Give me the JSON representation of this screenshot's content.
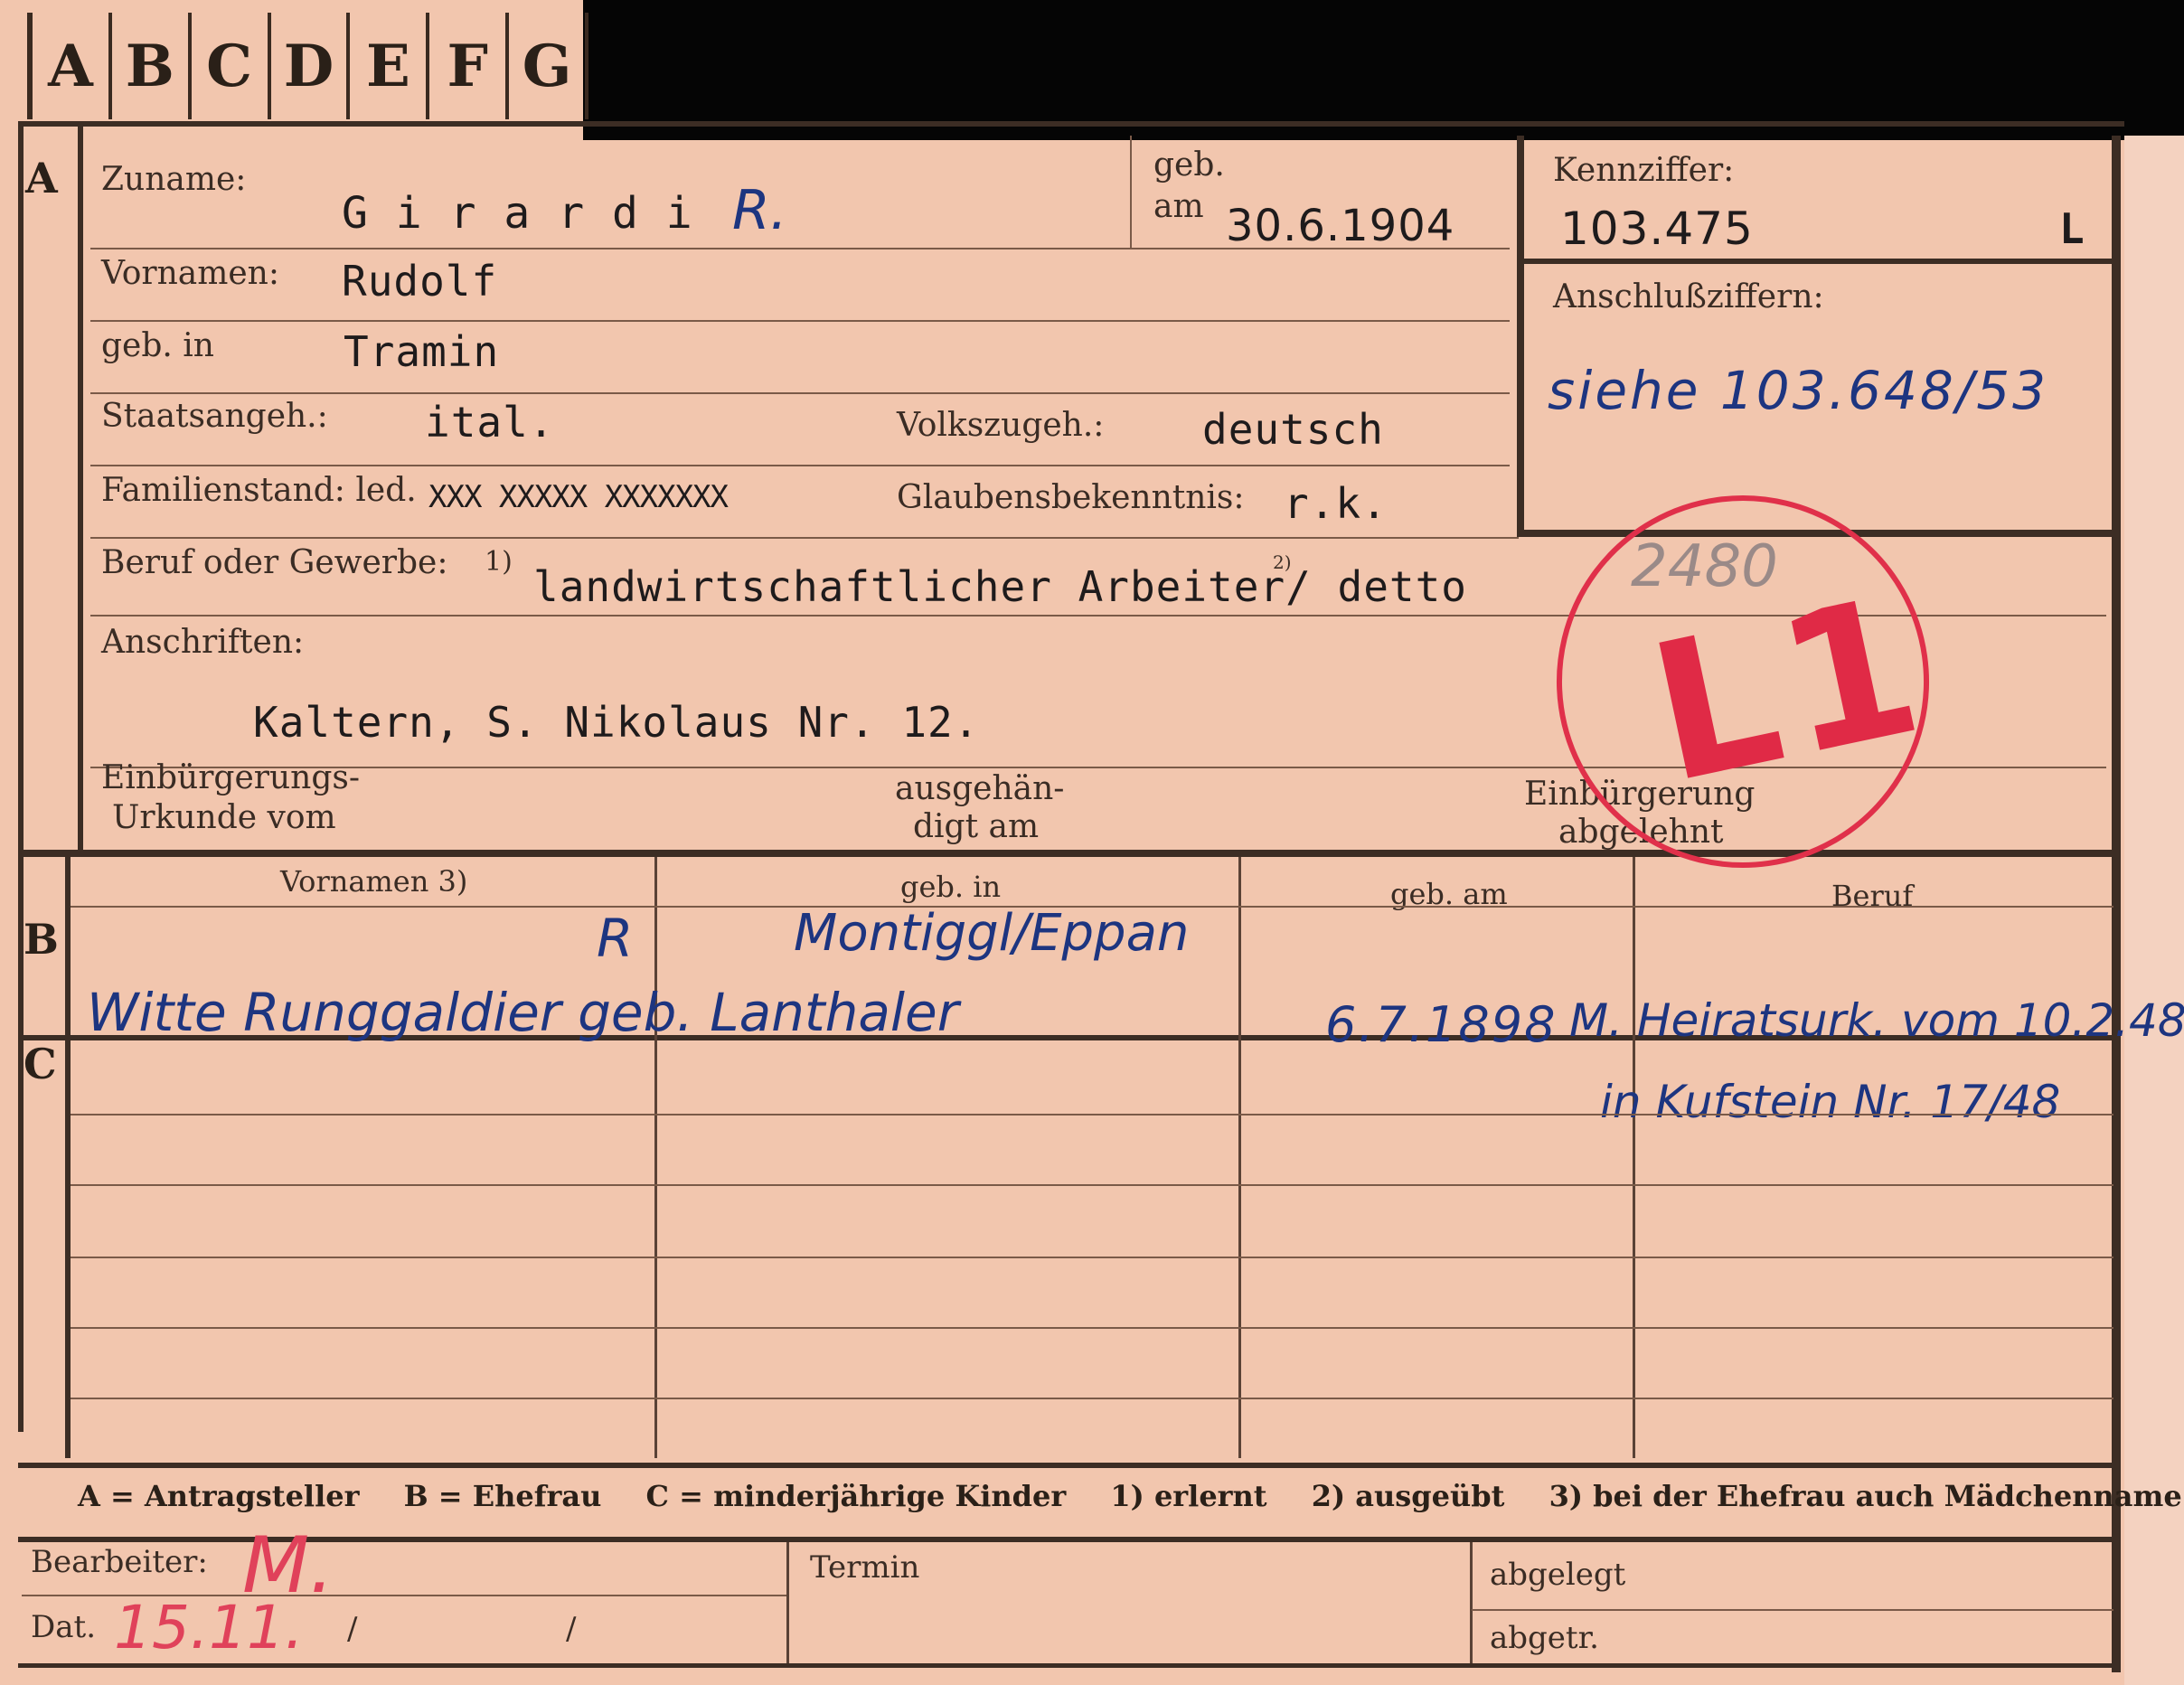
{
  "tabs": [
    "A",
    "B",
    "C",
    "D",
    "E",
    "F",
    "G"
  ],
  "sections": {
    "a": "A",
    "b": "B",
    "c": "C"
  },
  "labels": {
    "zuname": "Zuname:",
    "geb": "geb.",
    "am": "am",
    "vornamen": "Vornamen:",
    "geb_in": "geb. in",
    "staatsangeh": "Staatsangeh.:",
    "volkszugeh": "Volkszugeh.:",
    "familienstand": "Familienstand: led.",
    "glaubensbekenntnis": "Glaubensbekenntnis:",
    "beruf": "Beruf oder Gewerbe:",
    "footnote1": "1)",
    "footnote2": "2)",
    "anschriften": "Anschriften:",
    "einbuergerungs_1": "Einbürgerungs-",
    "einbuergerungs_2": "Urkunde vom",
    "ausgehaendigt_1": "ausgehän-",
    "ausgehaendigt_2": "digt am",
    "einbuergerung_1": "Einbürgerung",
    "einbuergerung_2": "abgelehnt",
    "kennziffer": "Kennziffer:",
    "anschlussziffern": "Anschlußziffern:",
    "bearbeiter": "Bearbeiter:",
    "dat": "Dat.",
    "termin": "Termin",
    "abgelegt": "abgelegt",
    "abgetr": "abgetr."
  },
  "values": {
    "zuname": "G i r a r d i",
    "zuname_mark": "R.",
    "geb_am": "30.6.1904",
    "vornamen": "Rudolf",
    "geb_in": "Tramin",
    "staatsangeh": "ital.",
    "volkszugeh": "deutsch",
    "familienstand_struck": "XXX XXXXX XXXXXXX",
    "glaubensbekenntnis": "r.k.",
    "beruf": "landwirtschaftlicher Arbeiter/ detto",
    "anschrift": "Kaltern, S. Nikolaus Nr. 12.",
    "kennziffer": "103.475",
    "kennziffer_suffix": "L",
    "anschlussziffern": "siehe 103.648/53"
  },
  "table": {
    "headers": [
      "Vornamen 3)",
      "geb. in",
      "geb. am",
      "Beruf"
    ],
    "row_b": {
      "mark": "R",
      "vornamen": "Witte Runggaldier geb. Lanthaler",
      "geb_in": "Montiggl/Eppan",
      "geb_am": "6.7.1898",
      "beruf": "M. Heiratsurk. vom 10.2.48",
      "beruf_2": "in Kufstein Nr. 17/48"
    }
  },
  "legend": [
    "A = Antragsteller",
    "B = Ehefrau",
    "C = minderjährige Kinder",
    "1) erlernt",
    "2) ausgeübt",
    "3) bei der Ehefrau auch Mädchenname"
  ],
  "stamp": {
    "text": "L1",
    "pencil": "2480",
    "color": "#e0304a"
  },
  "footer": {
    "bearbeiter_mark": "M.",
    "dat_value": "15.11.",
    "dat_sep1": "/",
    "dat_sep2": "/"
  }
}
